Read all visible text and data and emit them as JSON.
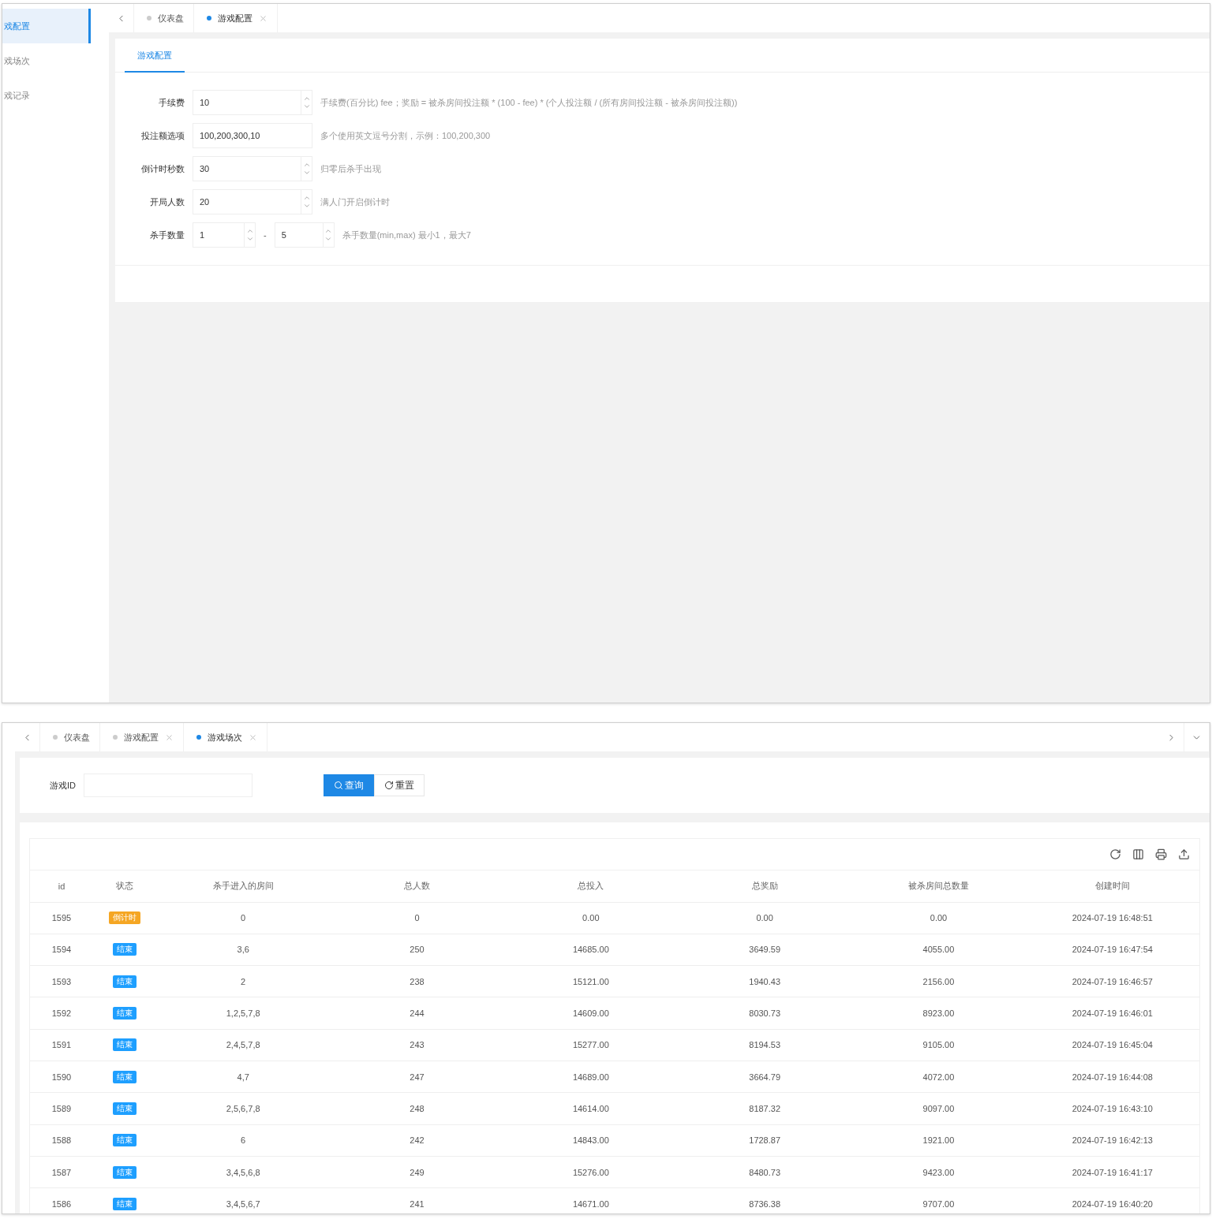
{
  "config_window": {
    "sidebar": {
      "items": [
        {
          "label": "戏配置",
          "selected": true
        },
        {
          "label": "戏场次",
          "selected": false
        },
        {
          "label": "戏记录",
          "selected": false
        }
      ]
    },
    "tabs": [
      {
        "label": "仪表盘",
        "selected": false,
        "closable": false
      },
      {
        "label": "游戏配置",
        "selected": true,
        "closable": true
      }
    ],
    "inner_tabs": [
      {
        "label": "游戏配置",
        "selected": true
      }
    ],
    "form": {
      "rows": [
        {
          "kind": "number",
          "label": "手续费",
          "value": "10",
          "hint": "手续费(百分比) fee；奖励 = 被杀房间投注额 * (100 - fee) * (个人投注额 / (所有房间投注额 - 被杀房间投注额))"
        },
        {
          "kind": "text",
          "label": "投注额选项",
          "value": "100,200,300,10",
          "hint": "多个使用英文逗号分割，示例：100,200,300"
        },
        {
          "kind": "number",
          "label": "倒计时秒数",
          "value": "30",
          "hint": "归零后杀手出现"
        },
        {
          "kind": "number",
          "label": "开局人数",
          "value": "20",
          "hint": "满人门开启倒计时"
        },
        {
          "kind": "range",
          "label": "杀手数量",
          "value": "1",
          "value_max": "5",
          "separator": "-",
          "hint": "杀手数量(min,max) 最小1，最大7"
        }
      ]
    }
  },
  "rounds_window": {
    "tabs": [
      {
        "label": "仪表盘",
        "selected": false,
        "closable": false
      },
      {
        "label": "游戏配置",
        "selected": false,
        "closable": true
      },
      {
        "label": "游戏场次",
        "selected": true,
        "closable": true
      }
    ],
    "search": {
      "label": "游戏ID",
      "buttons": [
        {
          "label": "查询",
          "kind": "primary"
        },
        {
          "label": "重置",
          "kind": "reset"
        }
      ]
    },
    "table": {
      "columns": [
        "id",
        "状态",
        "杀手进入的房间",
        "总人数",
        "总投入",
        "总奖励",
        "被杀房间总数量",
        "创建时间"
      ],
      "rows": [
        {
          "id": "1595",
          "status": {
            "label": "倒计时",
            "color": "#f5a623"
          },
          "rooms": "0",
          "players": "0",
          "bet": "0.00",
          "reward": "0.00",
          "killed": "0.00",
          "time": "2024-07-19 16:48:51"
        },
        {
          "id": "1594",
          "status": {
            "label": "结束",
            "color": "#1e9fff"
          },
          "rooms": "3,6",
          "players": "250",
          "bet": "14685.00",
          "reward": "3649.59",
          "killed": "4055.00",
          "time": "2024-07-19 16:47:54"
        },
        {
          "id": "1593",
          "status": {
            "label": "结束",
            "color": "#1e9fff"
          },
          "rooms": "2",
          "players": "238",
          "bet": "15121.00",
          "reward": "1940.43",
          "killed": "2156.00",
          "time": "2024-07-19 16:46:57"
        },
        {
          "id": "1592",
          "status": {
            "label": "结束",
            "color": "#1e9fff"
          },
          "rooms": "1,2,5,7,8",
          "players": "244",
          "bet": "14609.00",
          "reward": "8030.73",
          "killed": "8923.00",
          "time": "2024-07-19 16:46:01"
        },
        {
          "id": "1591",
          "status": {
            "label": "结束",
            "color": "#1e9fff"
          },
          "rooms": "2,4,5,7,8",
          "players": "243",
          "bet": "15277.00",
          "reward": "8194.53",
          "killed": "9105.00",
          "time": "2024-07-19 16:45:04"
        },
        {
          "id": "1590",
          "status": {
            "label": "结束",
            "color": "#1e9fff"
          },
          "rooms": "4,7",
          "players": "247",
          "bet": "14689.00",
          "reward": "3664.79",
          "killed": "4072.00",
          "time": "2024-07-19 16:44:08"
        },
        {
          "id": "1589",
          "status": {
            "label": "结束",
            "color": "#1e9fff"
          },
          "rooms": "2,5,6,7,8",
          "players": "248",
          "bet": "14614.00",
          "reward": "8187.32",
          "killed": "9097.00",
          "time": "2024-07-19 16:43:10"
        },
        {
          "id": "1588",
          "status": {
            "label": "结束",
            "color": "#1e9fff"
          },
          "rooms": "6",
          "players": "242",
          "bet": "14843.00",
          "reward": "1728.87",
          "killed": "1921.00",
          "time": "2024-07-19 16:42:13"
        },
        {
          "id": "1587",
          "status": {
            "label": "结束",
            "color": "#1e9fff"
          },
          "rooms": "3,4,5,6,8",
          "players": "249",
          "bet": "15276.00",
          "reward": "8480.73",
          "killed": "9423.00",
          "time": "2024-07-19 16:41:17"
        },
        {
          "id": "1586",
          "status": {
            "label": "结束",
            "color": "#1e9fff"
          },
          "rooms": "3,4,5,6,7",
          "players": "241",
          "bet": "14671.00",
          "reward": "8736.38",
          "killed": "9707.00",
          "time": "2024-07-19 16:40:20"
        }
      ]
    }
  }
}
